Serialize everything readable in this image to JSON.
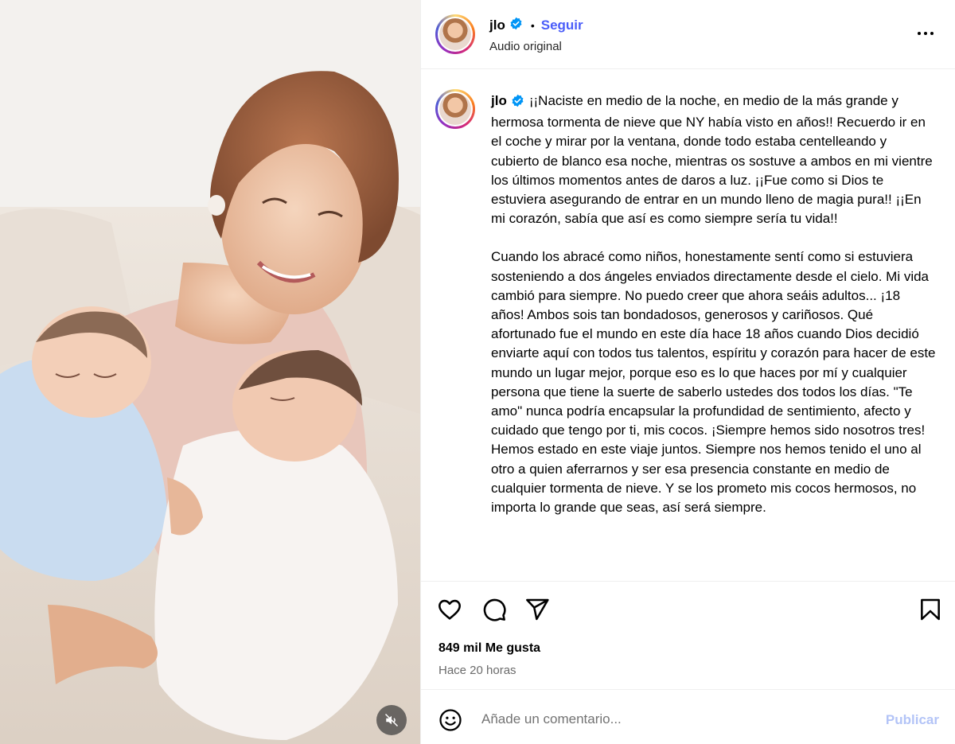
{
  "post": {
    "username": "jlo",
    "follow_label": "Seguir",
    "separator": "•",
    "audio_label": "Audio original",
    "caption_para1": "¡¡Naciste en medio de la noche, en medio de la más grande y hermosa tormenta de nieve que NY había visto en años!! Recuerdo ir en el coche y mirar por la ventana, donde todo estaba centelleando y cubierto de blanco esa noche, mientras os sostuve a ambos en mi vientre los últimos momentos antes de daros a luz. ¡¡Fue como si Dios te estuviera asegurando de entrar en un mundo lleno de magia pura!! ¡¡En mi corazón, sabía que así es como siempre sería tu vida!!",
    "caption_para2": "Cuando los abracé como niños, honestamente sentí como si estuviera sosteniendo a dos ángeles enviados directamente desde el cielo. Mi vida cambió para siempre. No puedo creer que ahora seáis adultos... ¡18 años! Ambos sois tan bondadosos, generosos y cariñosos. Qué afortunado fue el mundo en este día hace 18 años cuando Dios decidió enviarte aquí con todos tus talentos, espíritu y corazón para hacer de este mundo un lugar mejor, porque eso es lo que haces por mí y cualquier persona que tiene la suerte de saberlo ustedes dos todos los días. \"Te amo\" nunca podría encapsular la profundidad de sentimiento, afecto y cuidado que tengo por ti, mis cocos. ¡Siempre hemos sido nosotros tres! Hemos estado en este viaje juntos. Siempre nos hemos tenido el uno al otro a quien aferrarnos y ser esa presencia constante en medio de cualquier tormenta de nieve. Y se los prometo mis cocos hermosos, no importa lo grande que seas, así será siempre.",
    "likes": "849 mil Me gusta",
    "timestamp": "Hace 20 horas"
  },
  "comment": {
    "placeholder": "Añade un comentario...",
    "publish_label": "Publicar"
  },
  "icons": {
    "verified": "verified-badge-icon",
    "more": "more-options-icon",
    "like": "heart-icon",
    "comment": "comment-bubble-icon",
    "share": "paper-plane-icon",
    "save": "bookmark-icon",
    "emoji": "emoji-icon",
    "mute": "muted-speaker-icon"
  },
  "colors": {
    "follow": "#4a5df9",
    "verified": "#0095f6",
    "publish_disabled": "#b3c4f7"
  }
}
